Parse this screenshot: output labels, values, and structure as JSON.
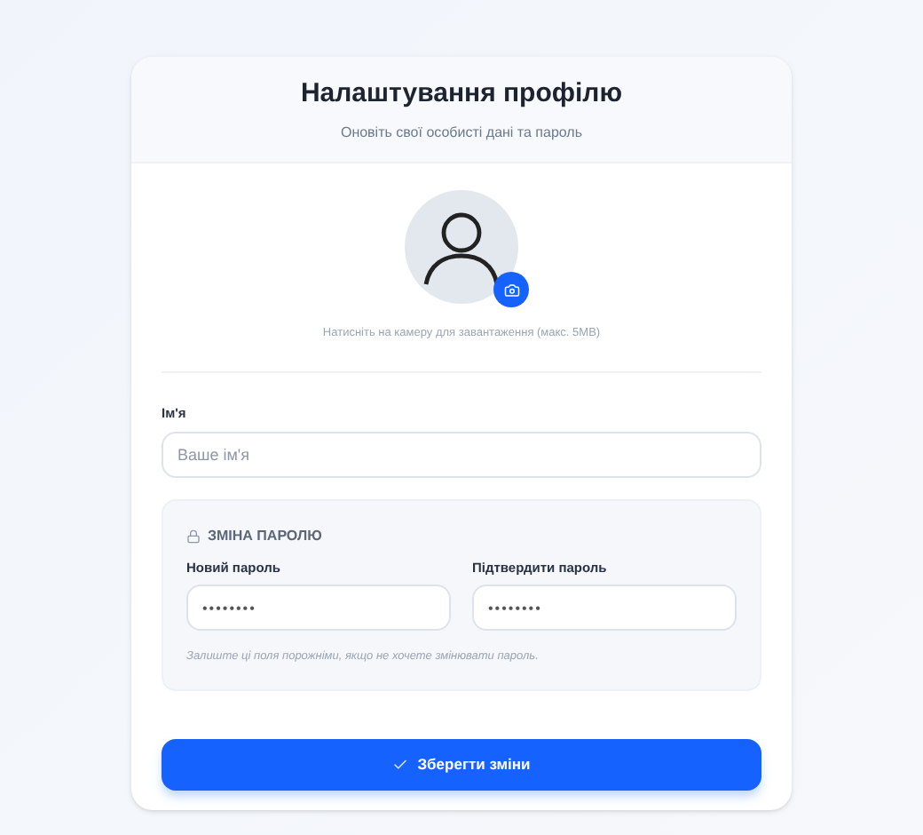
{
  "header": {
    "title": "Налаштування профілю",
    "subtitle": "Оновіть свої особисті дані та пароль"
  },
  "avatar": {
    "hint": "Натисніть на камеру для завантаження (макс. 5MB)"
  },
  "name_field": {
    "label": "Ім'я",
    "placeholder": "Ваше ім'я"
  },
  "password_section": {
    "title": "ЗМІНА ПАРОЛЮ",
    "fields": [
      {
        "label": "Новий пароль",
        "value": "••••••••"
      },
      {
        "label": "Підтвердити пароль",
        "value": "••••••••"
      }
    ],
    "note": "Залиште ці поля порожніми, якщо не хочете змінювати пароль."
  },
  "save_button": {
    "label": "Зберегти зміни"
  }
}
